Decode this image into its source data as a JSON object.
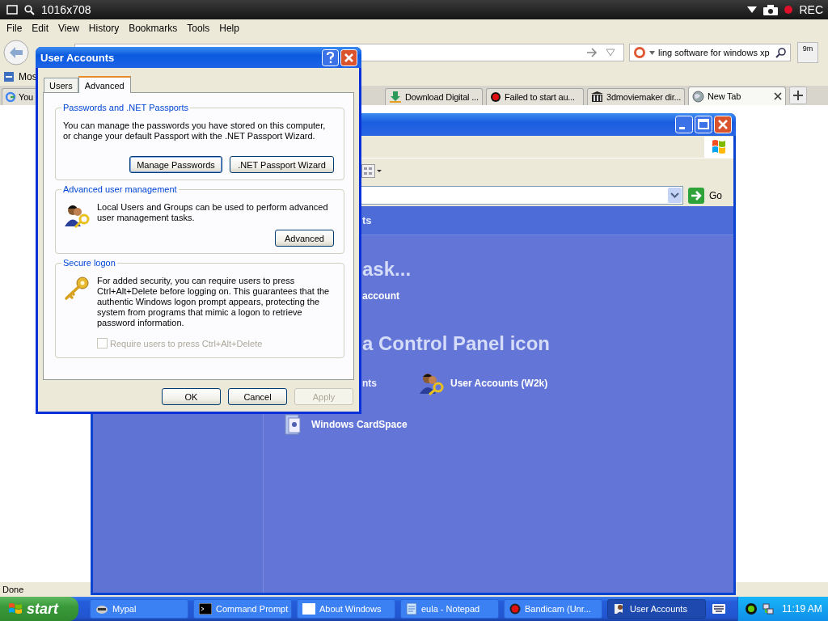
{
  "recorder": {
    "size": "1016x708",
    "rec": "REC"
  },
  "browser": {
    "menu": [
      "File",
      "Edit",
      "View",
      "History",
      "Bookmarks",
      "Tools",
      "Help"
    ],
    "search": {
      "value": "ling software for windows xp"
    },
    "addon_badge": "9m",
    "bookmarks": [
      "Mos"
    ],
    "tabs": [
      {
        "label": "You",
        "kind": "ring",
        "selected": false
      },
      {
        "label": "Download Digital ...",
        "kind": "download",
        "selected": false
      },
      {
        "label": "Failed to start au...",
        "kind": "dot",
        "selected": false
      },
      {
        "label": "3dmoviemaker dir...",
        "kind": "columns",
        "selected": false
      },
      {
        "label": "New Tab",
        "kind": "globe",
        "selected": true
      }
    ],
    "status": "Done"
  },
  "control_panel": {
    "header": "ts",
    "heading_1": "ask...",
    "task": "account",
    "heading_2": "a Control Panel icon",
    "icon_cut": "nts",
    "icons": [
      {
        "label": "User Accounts (W2k)"
      },
      {
        "label": "Windows CardSpace"
      }
    ],
    "go": "Go"
  },
  "dialog": {
    "title": "User Accounts",
    "tabs": [
      {
        "label": "Users",
        "selected": false
      },
      {
        "label": "Advanced",
        "selected": true
      }
    ],
    "passwords": {
      "title": "Passwords and .NET Passports",
      "text": "You can manage the passwords you have stored on this computer, or change your default Passport with the .NET Passport Wizard.",
      "buttons": [
        "Manage Passwords",
        ".NET Passport Wizard"
      ]
    },
    "user_management": {
      "title": "Advanced user management",
      "text": "Local Users and Groups can be used to perform advanced user management tasks.",
      "button": "Advanced"
    },
    "secure_logon": {
      "title": "Secure logon",
      "text": "For added security, you can require users to press Ctrl+Alt+Delete before logging on. This guarantees that the authentic Windows logon prompt appears, protecting the system from programs that mimic a logon to retrieve password information.",
      "checkbox": {
        "label": "Require users to press Ctrl+Alt+Delete",
        "checked": false,
        "disabled": true
      }
    },
    "buttons": [
      {
        "label": "OK",
        "disabled": false
      },
      {
        "label": "Cancel",
        "disabled": false
      },
      {
        "label": "Apply",
        "disabled": true
      }
    ]
  },
  "taskbar": {
    "start": "start",
    "items": [
      {
        "label": "Mypal",
        "kind": "browser",
        "selected": false
      },
      {
        "label": "Command Prompt",
        "kind": "console",
        "selected": false
      },
      {
        "label": "About Windows",
        "kind": "window",
        "selected": false
      },
      {
        "label": "eula - Notepad",
        "kind": "notepad",
        "selected": false
      },
      {
        "label": "Bandicam (Unr...",
        "kind": "recorder",
        "selected": false
      },
      {
        "label": "User Accounts",
        "kind": "users",
        "selected": true
      }
    ],
    "clock": "11:19 AM"
  }
}
